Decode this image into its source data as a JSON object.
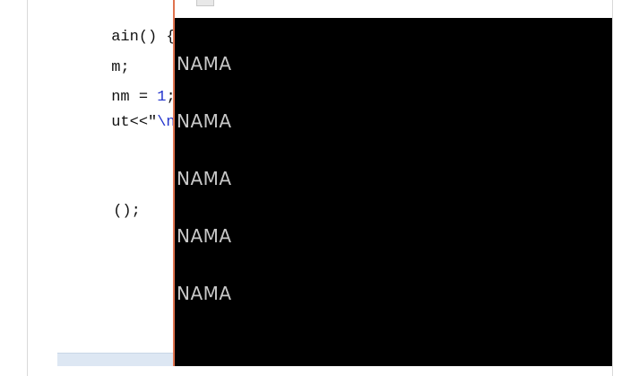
{
  "editor": {
    "lines": [
      {
        "text": "ain() {"
      },
      {
        "text": "m;"
      },
      {
        "text": "nm = ",
        "num": "1",
        "rest": ";"
      },
      {
        "text": "ut<<\"",
        "str": "\\nN"
      },
      {
        "text": "();"
      }
    ]
  },
  "console": {
    "output": [
      "NAMA",
      "NAMA",
      "NAMA",
      "NAMA",
      "NAMA"
    ]
  }
}
